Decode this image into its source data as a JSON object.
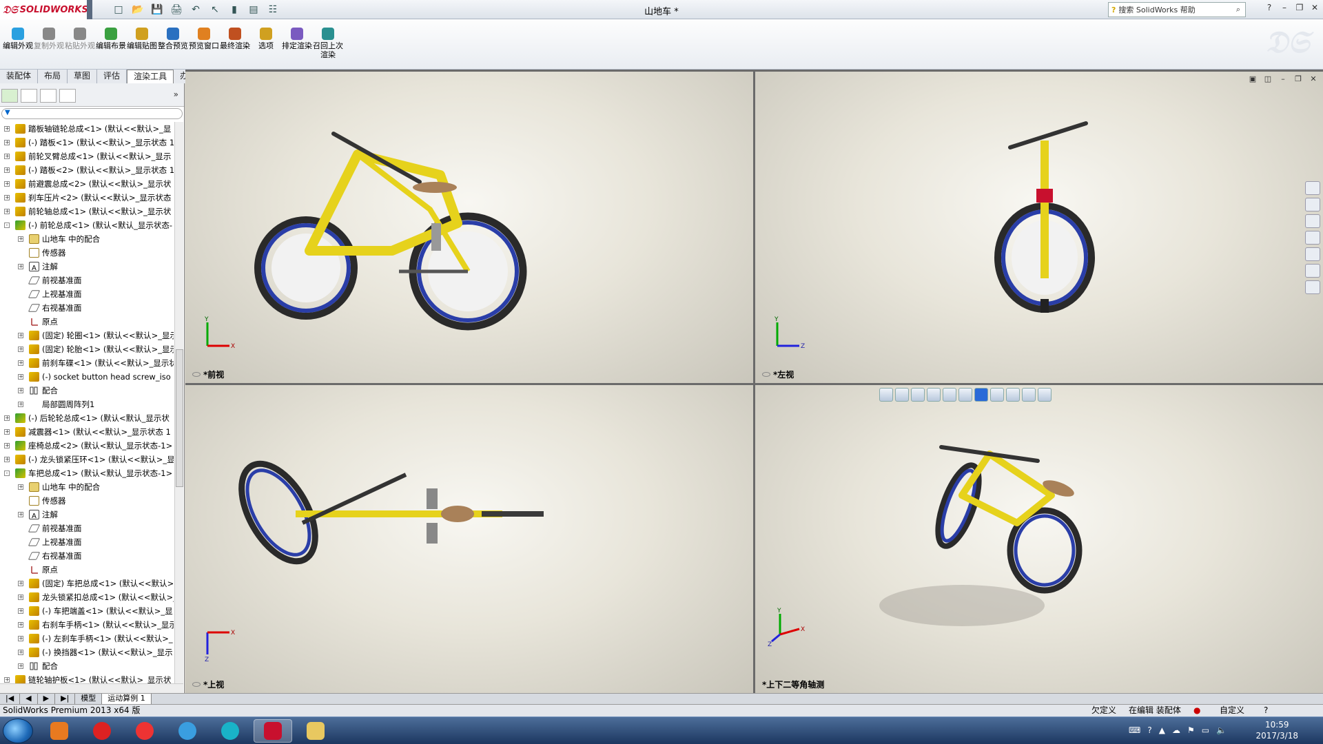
{
  "app": {
    "logo": "SOLIDWORKS",
    "doc_title": "山地车 *",
    "search_placeholder": "搜索 SolidWorks 帮助"
  },
  "ribbon": {
    "buttons": [
      {
        "label": "编辑外观",
        "disabled": false
      },
      {
        "label": "复制外观",
        "disabled": true
      },
      {
        "label": "粘贴外观",
        "disabled": true
      },
      {
        "label": "编辑布景",
        "disabled": false
      },
      {
        "label": "编辑贴图",
        "disabled": false
      },
      {
        "label": "整合预览",
        "disabled": false
      },
      {
        "label": "预览窗口",
        "disabled": false
      },
      {
        "label": "最终渲染",
        "disabled": false
      },
      {
        "label": "选项",
        "disabled": false
      },
      {
        "label": "排定渲染",
        "disabled": false
      },
      {
        "label": "召回上次渲染",
        "disabled": false
      }
    ]
  },
  "tabs": [
    "装配体",
    "布局",
    "草图",
    "评估",
    "渲染工具",
    "办公室产品"
  ],
  "active_tab": "渲染工具",
  "tree": [
    {
      "level": 0,
      "toggle": "+",
      "icon": "assembly",
      "label": "踏板轴链轮总成<1> (默认<<默认>_显"
    },
    {
      "level": 0,
      "toggle": "+",
      "icon": "assembly",
      "label": "(-) 踏板<1> (默认<<默认>_显示状态 1"
    },
    {
      "level": 0,
      "toggle": "+",
      "icon": "assembly",
      "label": "前轮叉臂总成<1> (默认<<默认>_显示"
    },
    {
      "level": 0,
      "toggle": "+",
      "icon": "assembly",
      "label": "(-) 踏板<2> (默认<<默认>_显示状态 1"
    },
    {
      "level": 0,
      "toggle": "+",
      "icon": "assembly",
      "label": "前避震总成<2> (默认<<默认>_显示状"
    },
    {
      "level": 0,
      "toggle": "+",
      "icon": "assembly",
      "label": "刹车压片<2> (默认<<默认>_显示状态"
    },
    {
      "level": 0,
      "toggle": "+",
      "icon": "assembly",
      "label": "前轮轴总成<1> (默认<<默认>_显示状"
    },
    {
      "level": 0,
      "toggle": "-",
      "icon": "subassembly",
      "label": "(-) 前轮总成<1> (默认<默认_显示状态-"
    },
    {
      "level": 1,
      "toggle": "+",
      "icon": "folder",
      "label": "山地车 中的配合"
    },
    {
      "level": 1,
      "toggle": "",
      "icon": "sensor",
      "label": "传感器"
    },
    {
      "level": 1,
      "toggle": "+",
      "icon": "note",
      "label": "注解"
    },
    {
      "level": 1,
      "toggle": "",
      "icon": "plane",
      "label": "前视基准面"
    },
    {
      "level": 1,
      "toggle": "",
      "icon": "plane",
      "label": "上视基准面"
    },
    {
      "level": 1,
      "toggle": "",
      "icon": "plane",
      "label": "右视基准面"
    },
    {
      "level": 1,
      "toggle": "",
      "icon": "origin",
      "label": "原点"
    },
    {
      "level": 1,
      "toggle": "+",
      "icon": "assembly",
      "label": "(固定) 轮圈<1> (默认<<默认>_显示"
    },
    {
      "level": 1,
      "toggle": "+",
      "icon": "assembly",
      "label": "(固定) 轮胎<1> (默认<<默认>_显示"
    },
    {
      "level": 1,
      "toggle": "+",
      "icon": "assembly",
      "label": "前刹车碟<1> (默认<<默认>_显示状"
    },
    {
      "level": 1,
      "toggle": "+",
      "icon": "screw",
      "label": "(-) socket button head screw_iso"
    },
    {
      "level": 1,
      "toggle": "+",
      "icon": "mate",
      "label": "配合"
    },
    {
      "level": 1,
      "toggle": "+",
      "icon": "pattern",
      "label": "局部圆周阵列1"
    },
    {
      "level": 0,
      "toggle": "+",
      "icon": "subassembly",
      "label": "(-) 后轮轮总成<1> (默认<默认_显示状"
    },
    {
      "level": 0,
      "toggle": "+",
      "icon": "assembly",
      "label": "减震器<1> (默认<<默认>_显示状态 1"
    },
    {
      "level": 0,
      "toggle": "+",
      "icon": "subassembly",
      "label": "座椅总成<2> (默认<默认_显示状态-1>"
    },
    {
      "level": 0,
      "toggle": "+",
      "icon": "assembly",
      "label": "(-) 龙头锁紧压环<1> (默认<<默认>_显"
    },
    {
      "level": 0,
      "toggle": "-",
      "icon": "subassembly",
      "label": "车把总成<1> (默认<默认_显示状态-1>"
    },
    {
      "level": 1,
      "toggle": "+",
      "icon": "folder",
      "label": "山地车 中的配合"
    },
    {
      "level": 1,
      "toggle": "",
      "icon": "sensor",
      "label": "传感器"
    },
    {
      "level": 1,
      "toggle": "+",
      "icon": "note",
      "label": "注解"
    },
    {
      "level": 1,
      "toggle": "",
      "icon": "plane",
      "label": "前视基准面"
    },
    {
      "level": 1,
      "toggle": "",
      "icon": "plane",
      "label": "上视基准面"
    },
    {
      "level": 1,
      "toggle": "",
      "icon": "plane",
      "label": "右视基准面"
    },
    {
      "level": 1,
      "toggle": "",
      "icon": "origin",
      "label": "原点"
    },
    {
      "level": 1,
      "toggle": "+",
      "icon": "assembly",
      "label": "(固定) 车把总成<1> (默认<<默认>_"
    },
    {
      "level": 1,
      "toggle": "+",
      "icon": "assembly",
      "label": "龙头锁紧扣总成<1> (默认<<默认>_"
    },
    {
      "level": 1,
      "toggle": "+",
      "icon": "assembly",
      "label": "(-) 车把端盖<1> (默认<<默认>_显"
    },
    {
      "level": 1,
      "toggle": "+",
      "icon": "assembly",
      "label": "右刹车手柄<1> (默认<<默认>_显示"
    },
    {
      "level": 1,
      "toggle": "+",
      "icon": "assembly",
      "label": "(-) 左刹车手柄<1> (默认<<默认>_"
    },
    {
      "level": 1,
      "toggle": "+",
      "icon": "assembly",
      "label": "(-) 换挡器<1> (默认<<默认>_显示"
    },
    {
      "level": 1,
      "toggle": "+",
      "icon": "mate",
      "label": "配合"
    },
    {
      "level": 0,
      "toggle": "+",
      "icon": "assembly",
      "label": "链轮轴护板<1> (默认<<默认>_显示状"
    }
  ],
  "viewports": {
    "front": "*前视",
    "left": "*左视",
    "top": "*上视",
    "iso": "*上下二等角轴测"
  },
  "axes": {
    "x": "X",
    "y": "Y",
    "z": "Z"
  },
  "bottom_tabs": [
    "模型",
    "运动算例 1"
  ],
  "status": {
    "product": "SolidWorks Premium 2013 x64 版",
    "underdefined": "欠定义",
    "editing": "在编辑 装配体",
    "custom": "自定义"
  },
  "clock": {
    "time": "10:59",
    "date": "2017/3/18"
  },
  "colors": {
    "frame": "#e6d21c",
    "rim": "#2a3ea8",
    "tire": "#2a2a2a",
    "saddle": "#a98159"
  }
}
